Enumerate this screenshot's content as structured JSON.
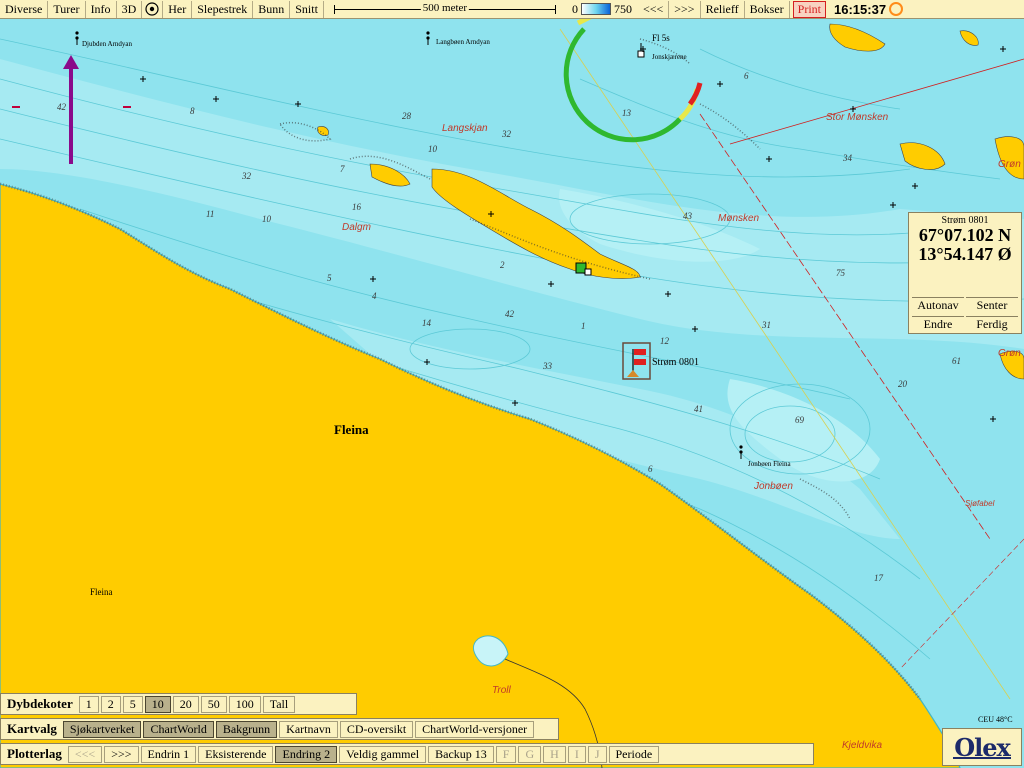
{
  "toolbar": {
    "items": [
      "Diverse",
      "Turer",
      "Info",
      "3D"
    ],
    "her": "Her",
    "items2": [
      "Slepestrek",
      "Bunn",
      "Snitt"
    ],
    "scale_label": "500 meter",
    "depth_min": "0",
    "depth_max": "750",
    "back": "<<<",
    "forward": ">>>",
    "relieff": "Relieff",
    "bokser": "Bokser",
    "print": "Print",
    "clock": "16:15:37"
  },
  "position_box": {
    "title": "Strøm 0801",
    "lat": "67°07.102 N",
    "lon": "13°54.147 Ø",
    "autonav": "Autonav",
    "senter": "Senter",
    "endre": "Endre",
    "ferdig": "Ferdig"
  },
  "map": {
    "land_label_main": "Fleina",
    "land_label_small": "Fleina",
    "mark_label": "Strøm 0801",
    "light_label": "Fl 5s",
    "place_names": {
      "langskjan": "Langskjan",
      "dalam": "Dalgm",
      "monsken": "Mønsken",
      "stor_monsken": "Stor Mønsken",
      "jonboen": "Jonbøen",
      "troll": "Troll",
      "kjeldvika": "Kjeldvika",
      "sjofabel": "Sjøfabel",
      "gron1": "Grøn",
      "gron2": "Grøn"
    },
    "buoy_labels": {
      "djubden": "Djubden Arndyan",
      "langboen": "Langbøen Arndyan",
      "jonskjaerene": "Jonskjærene",
      "jonboen_fleina": "Jonbøen Fleina"
    },
    "depths": [
      "42",
      "32",
      "11",
      "10",
      "16",
      "28",
      "32",
      "10",
      "43",
      "34",
      "75",
      "61",
      "20",
      "31",
      "41",
      "33",
      "42",
      "69",
      "17",
      "14",
      "5",
      "4",
      "6",
      "13",
      "12",
      "2",
      "1",
      "8",
      "7",
      "6"
    ],
    "corner_text": "CEU 48°C"
  },
  "dybdekoter": {
    "title": "Dybdekoter",
    "options": [
      "1",
      "2",
      "5",
      "10",
      "20",
      "50",
      "100",
      "Tall"
    ],
    "selected_index": 3
  },
  "kartvalg": {
    "title": "Kartvalg",
    "options": [
      "Sjøkartverket",
      "ChartWorld",
      "Bakgrunn",
      "Kartnavn",
      "CD-oversikt",
      "ChartWorld-versjoner"
    ],
    "active": [
      true,
      true,
      true,
      false,
      false,
      false
    ]
  },
  "plotterlag": {
    "title": "Plotterlag",
    "options": [
      "<<<",
      ">>>",
      "Endrin 1",
      "Eksisterende",
      "Endring 2",
      "Veldig gammel",
      "Backup 13",
      "F",
      "G",
      "H",
      "I",
      "J",
      "Periode"
    ],
    "active": [
      false,
      false,
      false,
      false,
      true,
      false,
      false,
      false,
      false,
      false,
      false,
      false,
      false
    ],
    "dim": [
      true,
      false,
      false,
      false,
      false,
      false,
      false,
      true,
      true,
      true,
      true,
      true,
      false
    ]
  },
  "logo": "Olex",
  "colors": {
    "sea": "#8fe3ee",
    "shallow": "#b8f0f4",
    "land": "#ffcc00",
    "panel": "#fbf2c0"
  }
}
